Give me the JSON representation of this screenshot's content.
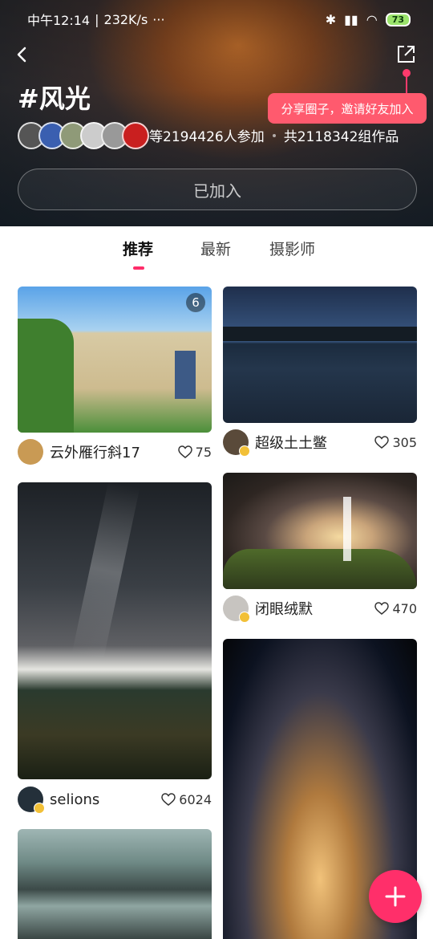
{
  "status_bar": {
    "time": "中午12:14",
    "speed": "232K/s",
    "dots": "···",
    "battery": "73"
  },
  "header": {
    "title": "#风光",
    "participants": "等2194426人参加",
    "works": "共2118342组作品",
    "join_button": "已加入",
    "share_tooltip": "分享圈子，邀请好友加入"
  },
  "tabs": [
    "推荐",
    "最新",
    "摄影师"
  ],
  "posts": [
    {
      "user": "云外雁行斜17",
      "likes": "75",
      "count": "6"
    },
    {
      "user": "超级土土鳖",
      "likes": "305"
    },
    {
      "user": "selions",
      "likes": "6024"
    },
    {
      "user": "闭眼绒默",
      "likes": "470"
    }
  ],
  "colors": {
    "accent": "#ff2d6a",
    "tooltip": "#ff5a6e"
  }
}
